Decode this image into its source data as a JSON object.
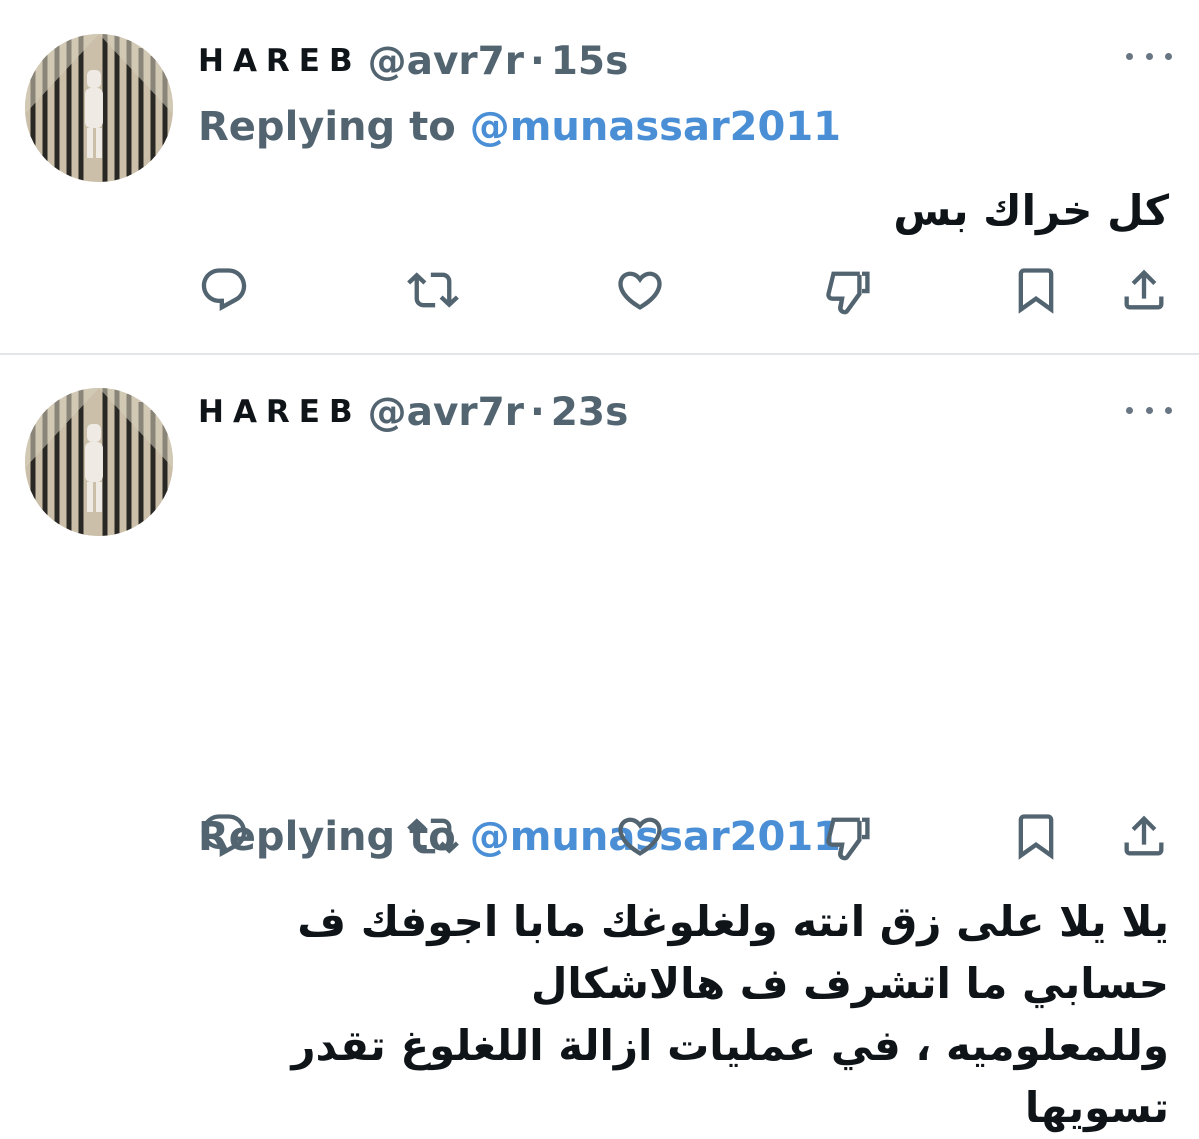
{
  "tweets": [
    {
      "display_name": "HAREB",
      "handle": "@avr7r",
      "separator": "·",
      "time": "15s",
      "replying_label": "Replying to",
      "replying_to": "@munassar2011",
      "text": "كل خراك بس"
    },
    {
      "display_name": "HAREB",
      "handle": "@avr7r",
      "separator": "·",
      "time": "23s",
      "replying_label": "Replying to",
      "replying_to": "@munassar2011",
      "text": "يلا يلا على زق انته ولغلوغك مابا اجوفك ف حسابي ما اتشرف ف هالاشكال\nوللمعلوميه ، في عمليات ازالة اللغلوغ تقدر تسويها"
    }
  ],
  "icons": {
    "reply": "reply-icon",
    "retweet": "retweet-icon",
    "like": "heart-icon",
    "dislike": "thumbs-down-icon",
    "bookmark": "bookmark-icon",
    "share": "share-icon",
    "more": "more-options-icon"
  },
  "colors": {
    "text": "#0f1419",
    "secondary": "#536471",
    "link": "#4a8fd6",
    "icon": "#536471",
    "divider": "#e3e6e9"
  }
}
